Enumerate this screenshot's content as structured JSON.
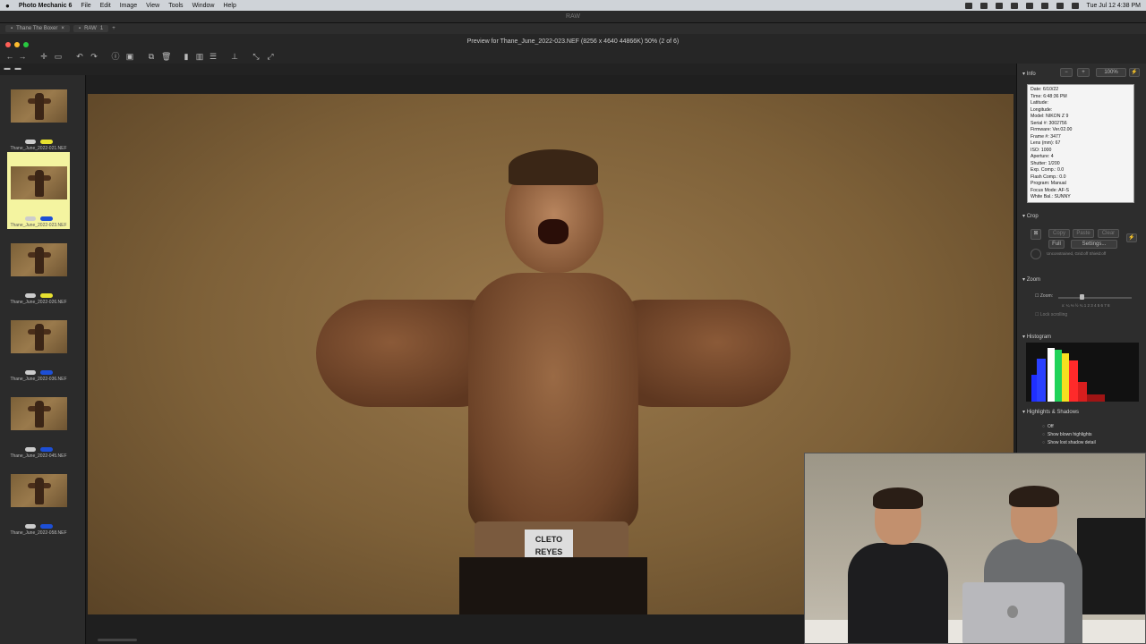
{
  "menubar": {
    "app": "Photo Mechanic 6",
    "items": [
      "File",
      "Edit",
      "Image",
      "View",
      "Tools",
      "Window",
      "Help"
    ],
    "datetime": "Tue Jul 12 4:38 PM"
  },
  "background_window": {
    "title": "RAW"
  },
  "tabs": [
    {
      "label": "Thane The Boxer"
    },
    {
      "label": "RAW",
      "count": "1"
    }
  ],
  "window": {
    "title": "Preview for Thane_June_2022-023.NEF (8256 x 4640 44866K) 50% (2 of 6)"
  },
  "thumbnails": [
    {
      "filename": "Thane_June_2022-021.NEF",
      "color_tag": "#e6e030",
      "selected": false
    },
    {
      "filename": "Thane_June_2022-023.NEF",
      "color_tag": "#1d4fd6",
      "selected": true
    },
    {
      "filename": "Thane_June_2022-026.NEF",
      "color_tag": "#e6e030",
      "selected": false
    },
    {
      "filename": "Thane_June_2022-036.NEF",
      "color_tag": "#1d4fd6",
      "selected": false
    },
    {
      "filename": "Thane_June_2022-045.NEF",
      "color_tag": "#1d4fd6",
      "selected": false
    },
    {
      "filename": "Thane_June_2022-058.NEF",
      "color_tag": "#1d4fd6",
      "selected": false
    }
  ],
  "photo": {
    "belt_text_1": "CLETO",
    "belt_text_2": "REYES"
  },
  "info_panel": {
    "header": "Info",
    "zoom_value": "100%",
    "minus": "−",
    "plus": "+",
    "lines": [
      "Date: 6/10/22",
      "Time: 6:48:36 PM",
      "Latitude:",
      "Longitude:",
      "Model: NIKON Z 9",
      "Serial #: 3002756",
      "Firmware: Ver.02.00",
      "Frame #: 3477",
      "Lens (mm): 67",
      "ISO: 1000",
      "Aperture: 4",
      "Shutter: 1/200",
      "Exp. Comp.: 0.0",
      "Flash Comp.: 0.0",
      "Program: Manual",
      "Focus Mode: AF-S",
      "White Bal.: SUNNY"
    ]
  },
  "crop_panel": {
    "header": "Crop",
    "copy": "Copy",
    "paste": "Paste",
    "clear": "Clear",
    "full": "Full",
    "settings": "Settings...",
    "status": "Unconstrained, Grid:off Shield:off"
  },
  "zoom_panel": {
    "header": "Zoom",
    "zoom_label": "Zoom:",
    "scale": "x: ¼ ⅓ ½ ¾ 1 2 3 4 5 6 7 8",
    "lock": "Lock scrolling"
  },
  "histogram_panel": {
    "header": "Histogram"
  },
  "highlights_panel": {
    "header": "Highlights & Shadows",
    "options": [
      "Off",
      "Show blown highlights",
      "Show lost shadow detail"
    ]
  },
  "colors": {
    "selected_thumb": "#f4f4a0",
    "tag_yellow": "#e6e030",
    "tag_blue": "#1d4fd6"
  }
}
